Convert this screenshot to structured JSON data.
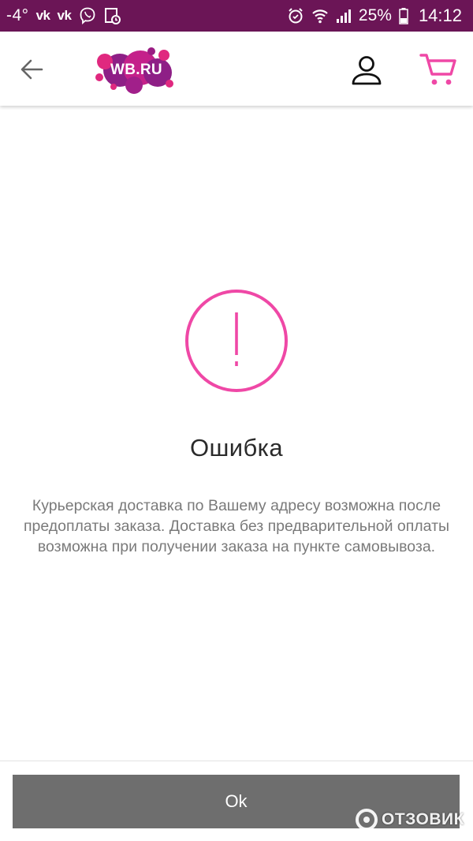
{
  "status_bar": {
    "temperature": "-4°",
    "vk_label_1": "vk",
    "vk_label_2": "vk",
    "battery_percent": "25%",
    "time": "14:12",
    "icons": [
      "viber-icon",
      "calendar-clock-icon",
      "alarm-icon",
      "wifi-icon",
      "signal-icon",
      "battery-icon"
    ]
  },
  "app_bar": {
    "logo_text": "WB.RU",
    "icons": [
      "back-arrow-icon",
      "profile-icon",
      "cart-icon"
    ]
  },
  "dialog": {
    "title": "Ошибка",
    "message": "Курьерская доставка по Вашему адресу возможна после предоплаты заказа. Доставка без предварительной оплаты возможна при получении заказа на пункте самовывоза.",
    "ok_label": "Ok",
    "icon": "exclamation-circle-icon"
  },
  "watermark": {
    "text": "ОТЗОВИК",
    "icon": "otzovik-logo-icon"
  },
  "colors": {
    "status_bar_bg": "#6b1556",
    "accent_pink": "#ef48a6",
    "logo_purple": "#8e1f86",
    "logo_magenta": "#e0287f",
    "button_gray": "#6e6e6e",
    "title_text": "#2a2a2a",
    "message_text": "#7a7a7a"
  }
}
